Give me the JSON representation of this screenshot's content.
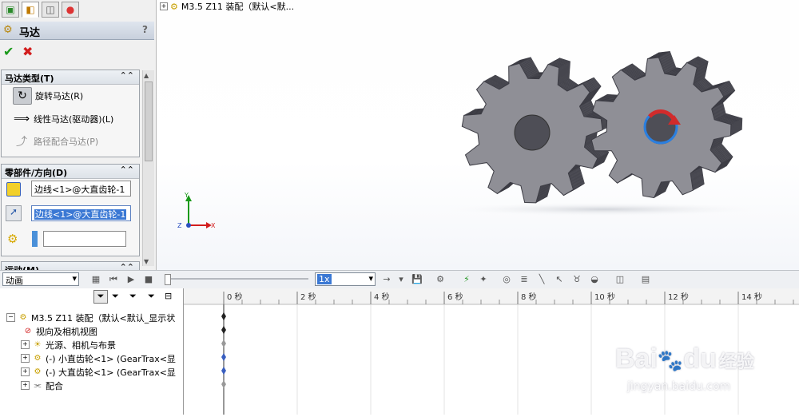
{
  "pm": {
    "tabs": [
      "feature-manager",
      "property-manager",
      "configuration-manager",
      "display-manager"
    ],
    "title": "马达",
    "help": "?",
    "motor_type": {
      "header": "马达类型(T)",
      "options": [
        {
          "label": "旋转马达(R)"
        },
        {
          "label": "线性马达(驱动器)(L)"
        },
        {
          "label": "路径配合马达(P)"
        }
      ]
    },
    "component": {
      "header": "零部件/方向(D)",
      "field1": "边线<1>@大直齿轮-1",
      "field2": "边线<1>@大直齿轮-1",
      "field3": ""
    },
    "next_header": "运动(M)"
  },
  "gfx": {
    "tree_label": "M3.5 Z11 装配（默认<默...",
    "triad": {
      "y": "Y",
      "x": "X",
      "z": "Z"
    },
    "colors": {
      "gear": "#8f8f96",
      "gear_dark": "#5a5a62",
      "arrow": "#d22b2b",
      "circle": "#2a7fe0"
    }
  },
  "toolbar": {
    "study_type": "动画",
    "playback_speed": "1x"
  },
  "timeline": {
    "ticks": [
      "0 秒",
      "2 秒",
      "4 秒",
      "6 秒",
      "8 秒",
      "10 秒",
      "12 秒",
      "14 秒"
    ],
    "tree": [
      {
        "label": "M3.5 Z11 装配（默认<默认_显示状"
      },
      {
        "label": "视向及相机视图"
      },
      {
        "label": "光源、相机与布景"
      },
      {
        "label": "(-) 小直齿轮<1> (GearTrax<显"
      },
      {
        "label": "(-) 大直齿轮<1> (GearTrax<显"
      },
      {
        "label": "配合"
      }
    ],
    "keyframes": [
      {
        "row": 0,
        "time": 0,
        "kind": "black"
      },
      {
        "row": 1,
        "time": 0,
        "kind": "black"
      },
      {
        "row": 2,
        "time": 0,
        "kind": "gray"
      },
      {
        "row": 3,
        "time": 0,
        "kind": "blue"
      },
      {
        "row": 4,
        "time": 0,
        "kind": "blue"
      },
      {
        "row": 5,
        "time": 0,
        "kind": "gray"
      }
    ]
  },
  "watermark": {
    "brand": "Bai",
    "brand2": "du",
    "cn": "经验",
    "url": "jingyan.baidu.com"
  }
}
